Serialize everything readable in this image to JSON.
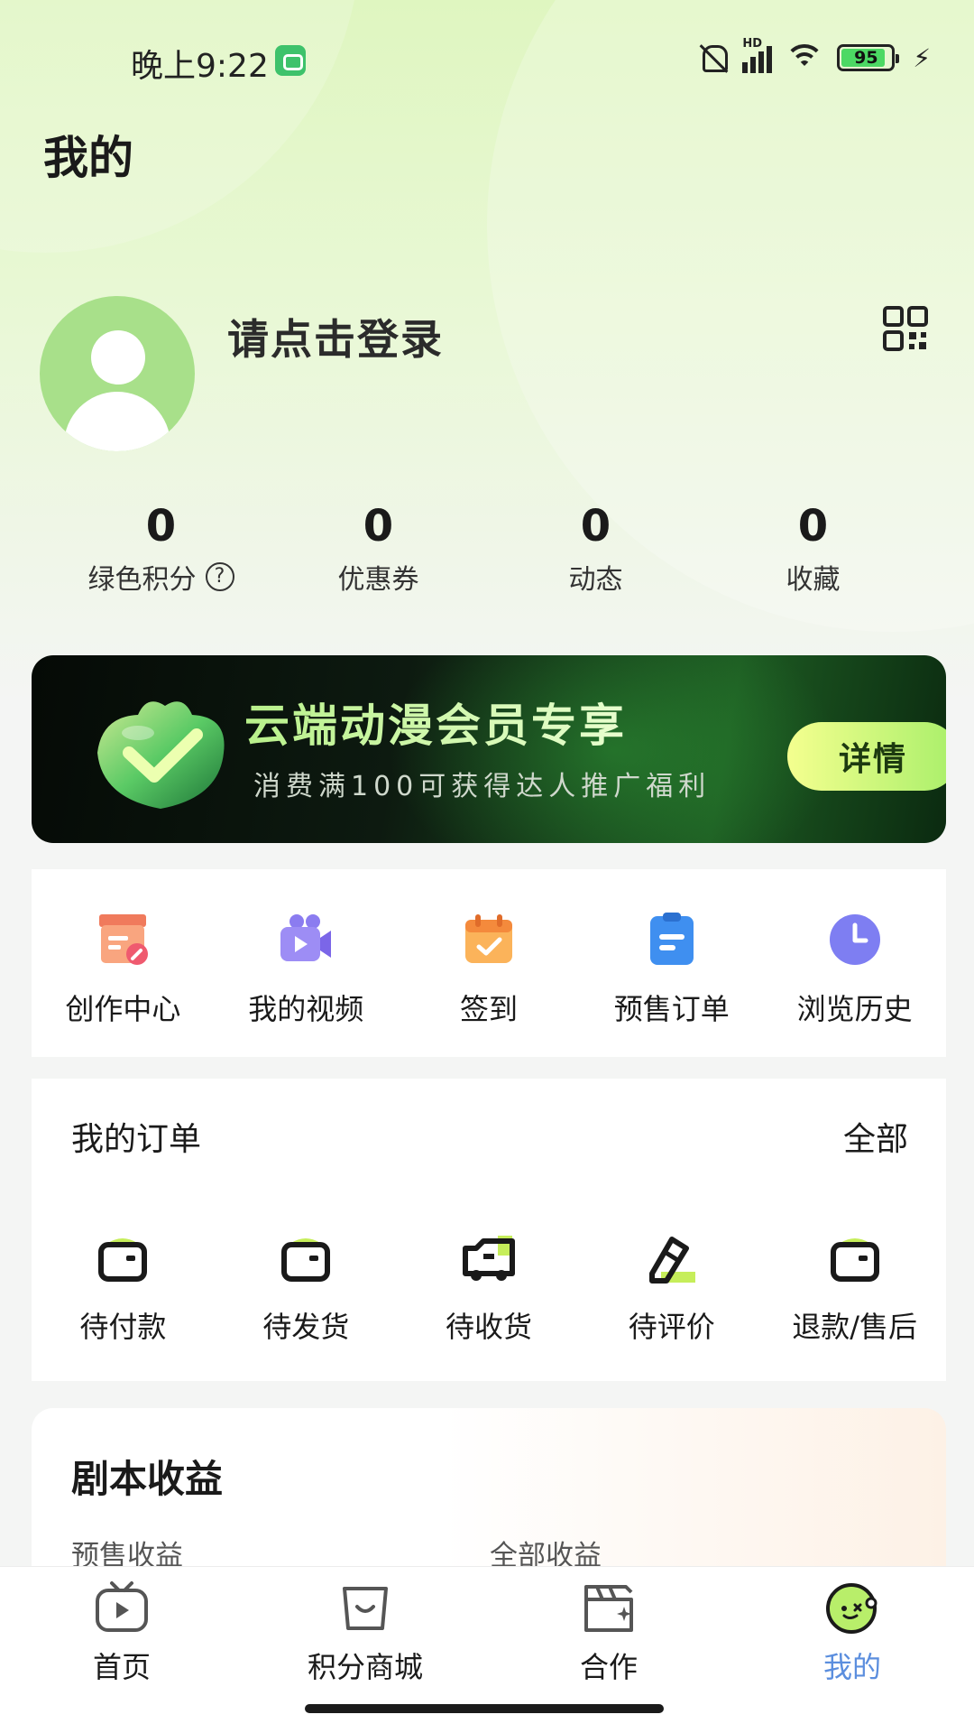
{
  "status_bar": {
    "time": "晚上9:22",
    "network": "HD",
    "battery": "95"
  },
  "page": {
    "title": "我的"
  },
  "profile": {
    "login_prompt": "请点击登录"
  },
  "stats": [
    {
      "value": "0",
      "label": "绿色积分"
    },
    {
      "value": "0",
      "label": "优惠券"
    },
    {
      "value": "0",
      "label": "动态"
    },
    {
      "value": "0",
      "label": "收藏"
    }
  ],
  "banner": {
    "title": "云端动漫会员专享",
    "subtitle": "消费满100可获得达人推广福利",
    "button": "详情"
  },
  "quick_actions": [
    {
      "label": "创作中心",
      "icon": "creation-center-icon"
    },
    {
      "label": "我的视频",
      "icon": "video-camera-icon"
    },
    {
      "label": "签到",
      "icon": "calendar-check-icon"
    },
    {
      "label": "预售订单",
      "icon": "clipboard-icon"
    },
    {
      "label": "浏览历史",
      "icon": "clock-icon"
    }
  ],
  "orders": {
    "title": "我的订单",
    "all_label": "全部",
    "items": [
      {
        "label": "待付款",
        "icon": "wallet-icon"
      },
      {
        "label": "待发货",
        "icon": "wallet-icon"
      },
      {
        "label": "待收货",
        "icon": "truck-icon"
      },
      {
        "label": "待评价",
        "icon": "pen-icon"
      },
      {
        "label": "退款/售后",
        "icon": "wallet-icon"
      }
    ]
  },
  "earnings": {
    "title": "剧本收益",
    "presale_label": "预售收益",
    "total_label": "全部收益"
  },
  "bottom_nav": [
    {
      "label": "首页",
      "icon": "tv-icon",
      "active": false
    },
    {
      "label": "积分商城",
      "icon": "shopping-bag-icon",
      "active": false
    },
    {
      "label": "合作",
      "icon": "clapperboard-icon",
      "active": false
    },
    {
      "label": "我的",
      "icon": "mascot-face-icon",
      "active": true
    }
  ],
  "colors": {
    "active_tab": "#5b8ede",
    "accent_green": "#a8ef6a",
    "avatar_bg": "#a8e08a"
  }
}
